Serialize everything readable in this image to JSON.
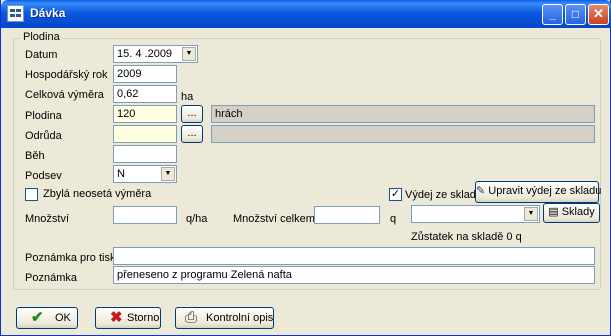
{
  "window": {
    "title": "Dávka"
  },
  "group": {
    "title": "Plodina"
  },
  "labels": {
    "datum": "Datum",
    "hospodarsky_rok": "Hospodářský rok",
    "celkova_vymera": "Celková výměra",
    "vymera_unit": "ha",
    "plodina": "Plodina",
    "odruda": "Odrůda",
    "beh": "Běh",
    "podsev": "Podsev",
    "zbyla": "Zbylá neosetá výměra",
    "vydej": "Výdej ze skladu",
    "mnozstvi": "Množství",
    "mnozstvi_unit": "q/ha",
    "mnozstvi_celkem": "Množství celkem",
    "mnozstvi_celkem_unit": "q",
    "zustatek": "Zůstatek na skladě",
    "zustatek_value": "0",
    "zustatek_unit": "q",
    "poznamka_tisk": "Poznámka pro tisk",
    "poznamka": "Poznámka"
  },
  "values": {
    "datum": "15. 4 .2009",
    "hospodarsky_rok": "2009",
    "celkova_vymera": "0,62",
    "plodina_code": "120",
    "plodina_name": "hrách",
    "odruda": "",
    "beh": "",
    "podsev": "N",
    "mnozstvi": "",
    "mnozstvi_celkem": "",
    "sklad": "",
    "poznamka_tisk": "",
    "poznamka": "přeneseno z programu Zelená nafta"
  },
  "state": {
    "zbyla_checked": false,
    "vydej_checked": true
  },
  "buttons": {
    "ellipsis": "...",
    "upravit": "Upravit výdej ze skladu",
    "sklady": "Sklady",
    "ok": "OK",
    "storno": "Storno",
    "kontrolni": "Kontrolní opis"
  },
  "titlebar_buttons": {
    "minimize": "_",
    "maximize": "□",
    "close": "✕"
  },
  "icons": {
    "app": "grid-icon",
    "ok": "check-icon",
    "storno": "cross-icon",
    "kontrolni": "printer-icon",
    "upravit": "edit-icon",
    "sklady": "list-icon"
  }
}
